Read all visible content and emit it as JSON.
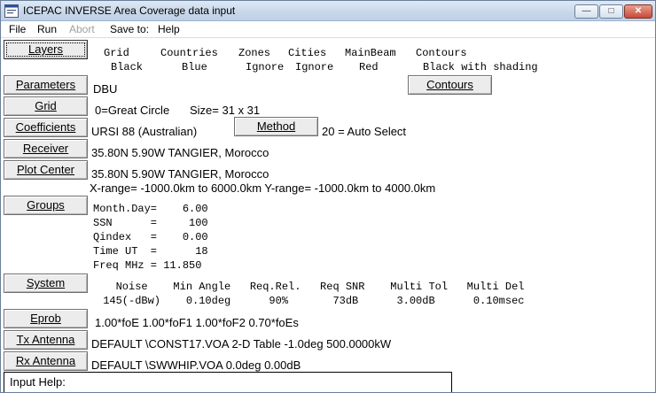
{
  "window": {
    "title": "ICEPAC INVERSE Area Coverage data input",
    "min_glyph": "—",
    "max_glyph": "□",
    "close_glyph": "✕"
  },
  "menu": [
    "File",
    "Run",
    "Abort",
    "Save to:",
    "Help"
  ],
  "sidebar": {
    "layers": "Layers",
    "parameters": "Parameters",
    "grid": "Grid",
    "coefficients": "Coefficients",
    "receiver": "Receiver",
    "plot_center": "Plot Center",
    "groups": "Groups",
    "system": "System",
    "eprob": "Eprob",
    "tx_antenna": "Tx Antenna",
    "rx_antenna": "Rx Antenna"
  },
  "layers": {
    "headers": [
      "Grid",
      "Countries",
      "Zones",
      "Cities",
      "MainBeam",
      "Contours"
    ],
    "values": [
      "Black",
      "Blue",
      "Ignore",
      "Ignore",
      "Red",
      "Black with shading"
    ]
  },
  "parameters": {
    "value": "DBU",
    "contours_button": "Contours"
  },
  "grid": {
    "type": "0=Great Circle",
    "size": "Size= 31 x 31"
  },
  "coefficients": {
    "value": "URSI 88 (Australian)",
    "method_button": "Method",
    "method_value": "20 = Auto Select"
  },
  "receiver": {
    "value": "35.80N    5.90W  TANGIER, Morocco"
  },
  "plot_center": {
    "value": "35.80N    5.90W  TANGIER, Morocco",
    "range": "X-range= -1000.0km  to   6000.0km     Y-range= -1000.0km  to   4000.0km"
  },
  "groups": {
    "lines": [
      "Month.Day=    6.00",
      "SSN      =     100",
      "Qindex   =    0.00",
      "Time UT  =      18",
      "Freq MHz = 11.850"
    ]
  },
  "system": {
    "headers": "   Noise    Min Angle   Req.Rel.   Req SNR    Multi Tol   Multi Del",
    "values": " 145(-dBw)    0.10deg      90%       73dB      3.00dB      0.10msec"
  },
  "eprob": {
    "value": "1.00*foE   1.00*foF1   1.00*foF2   0.70*foEs"
  },
  "tx_antenna": {
    "value": "DEFAULT \\CONST17.VOA  2-D Table   -1.0deg  500.0000kW"
  },
  "rx_antenna": {
    "value": "DEFAULT \\SWWHIP.VOA     0.0deg  0.00dB"
  },
  "input_help": {
    "label": "Input Help:"
  }
}
